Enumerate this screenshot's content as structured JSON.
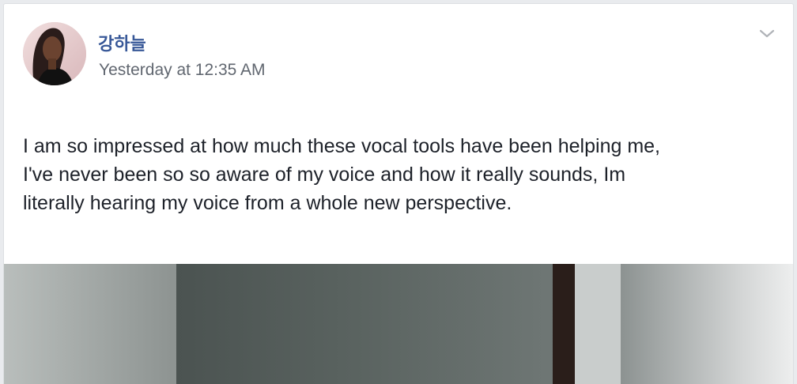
{
  "post": {
    "author_name": "강하늘",
    "timestamp": "Yesterday at 12:35 AM",
    "text_lines": [
      "I am so impressed at how much these vocal tools have been helping me,",
      "I've never been so so aware of my voice and how it really sounds, Im",
      "literally hearing my voice from a whole new perspective."
    ],
    "options_icon": "chevron-down-icon",
    "avatar_icon": "profile-photo",
    "media_icon": "video-frame"
  },
  "colors": {
    "author_link": "#385898",
    "secondary_text": "#616770",
    "body_text": "#1d2129"
  }
}
